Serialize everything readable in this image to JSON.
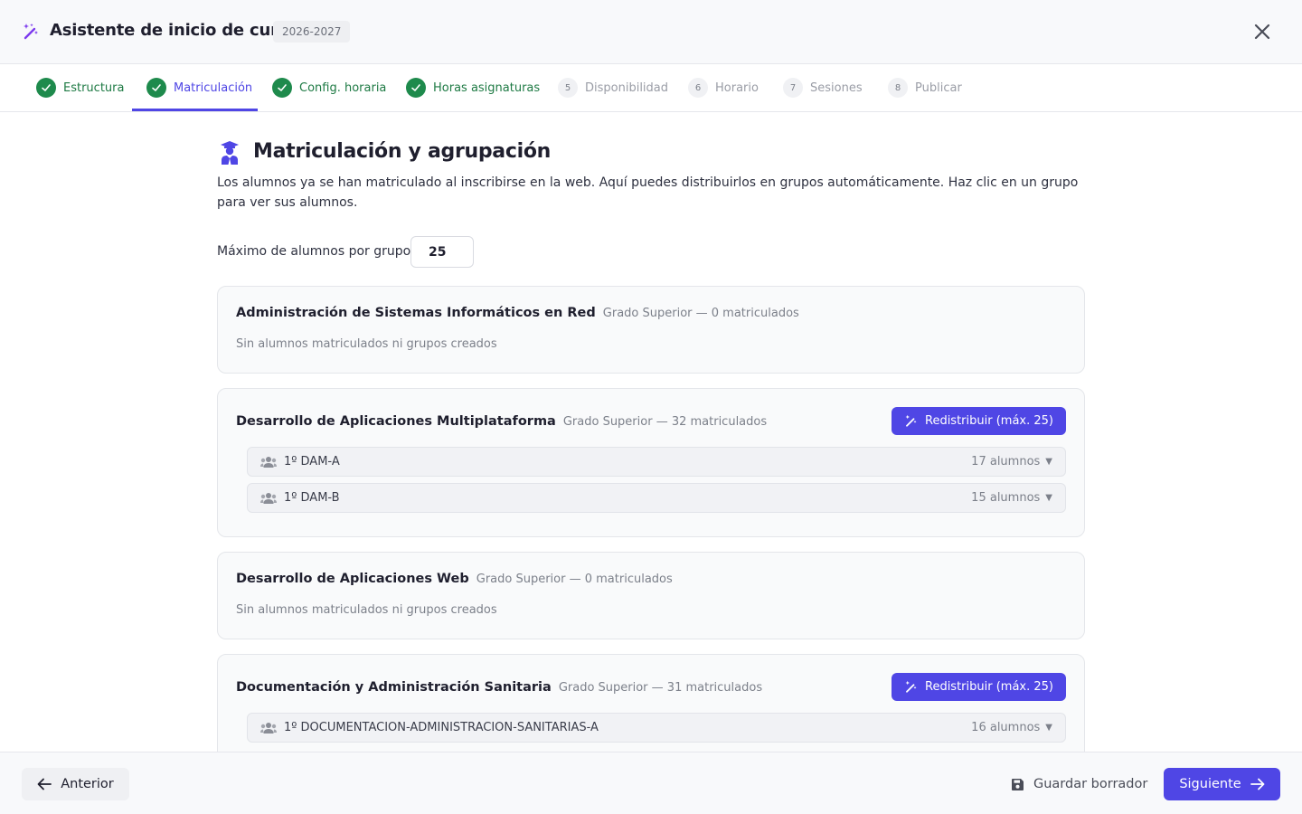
{
  "header": {
    "title": "Asistente de inicio de curso",
    "year": "2026-2027"
  },
  "steps": [
    {
      "label": "Estructura",
      "state": "done"
    },
    {
      "label": "Matriculación",
      "state": "active"
    },
    {
      "label": "Config. horaria",
      "state": "done"
    },
    {
      "label": "Horas asignaturas",
      "state": "done"
    },
    {
      "num": "5",
      "label": "Disponibilidad",
      "state": "pending"
    },
    {
      "num": "6",
      "label": "Horario",
      "state": "pending"
    },
    {
      "num": "7",
      "label": "Sesiones",
      "state": "pending"
    },
    {
      "num": "8",
      "label": "Publicar",
      "state": "pending"
    }
  ],
  "main": {
    "title": "Matriculación y agrupación",
    "description": "Los alumnos ya se han matriculado al inscribirse en la web. Aquí puedes distribuirlos en grupos automáticamente. Haz clic en un grupo para ver sus alumnos.",
    "max_label": "Máximo de alumnos por grupo:",
    "max_value": "25"
  },
  "cycles": [
    {
      "name": "Administración de Sistemas Informáticos en Red",
      "meta": "Grado Superior — 0 matriculados",
      "empty": "Sin alumnos matriculados ni grupos creados"
    },
    {
      "name": "Desarrollo de Aplicaciones Multiplataforma",
      "meta": "Grado Superior — 32 matriculados",
      "button": "Redistribuir (máx. 25)",
      "groups": [
        {
          "name": "1º DAM-A",
          "count": "17 alumnos"
        },
        {
          "name": "1º DAM-B",
          "count": "15 alumnos"
        }
      ]
    },
    {
      "name": "Desarrollo de Aplicaciones Web",
      "meta": "Grado Superior — 0 matriculados",
      "empty": "Sin alumnos matriculados ni grupos creados"
    },
    {
      "name": "Documentación y Administración Sanitaria",
      "meta": "Grado Superior — 31 matriculados",
      "button": "Redistribuir (máx. 25)",
      "groups": [
        {
          "name": "1º DOCUMENTACION-ADMINISTRACION-SANITARIAS-A",
          "count": "16 alumnos"
        }
      ]
    }
  ],
  "footer": {
    "prev": "Anterior",
    "save": "Guardar borrador",
    "next": "Siguiente"
  },
  "colors": {
    "accent": "#4f46e5",
    "success": "#1e8a4c"
  }
}
